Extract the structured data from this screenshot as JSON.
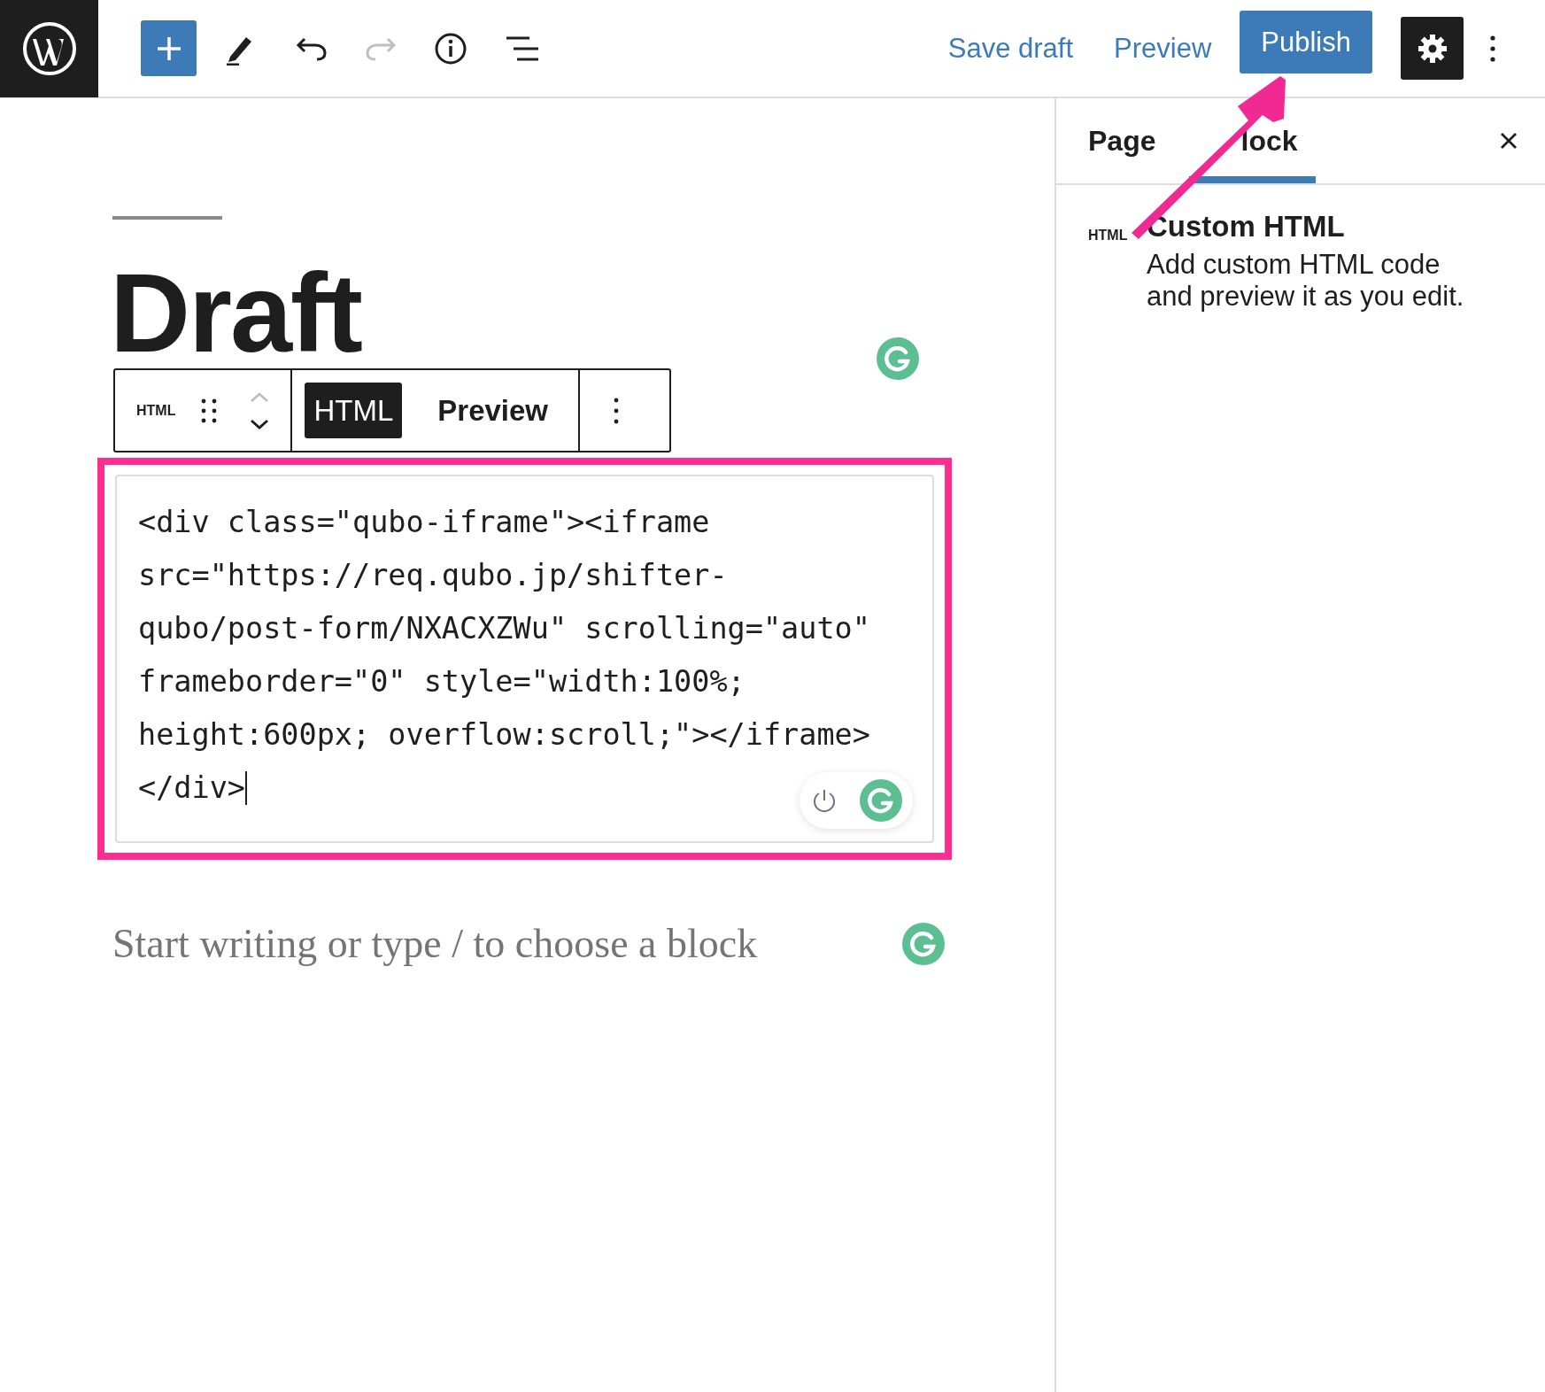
{
  "top_bar": {
    "history": [
      {
        "kind": "undo",
        "disabled": false
      },
      {
        "kind": "redo",
        "disabled": true
      }
    ],
    "save_draft": "Save draft",
    "preview": "Preview",
    "publish": "Publish",
    "settings": {
      "selected": true
    }
  },
  "editor": {
    "title": "Draft",
    "block_toolbar": {
      "block_label": "HTML",
      "modes": [
        {
          "label": "HTML",
          "selected": true
        },
        {
          "label": "Preview",
          "selected": false
        }
      ]
    },
    "code_lines": [
      "<div class=\"qubo-iframe\"><iframe",
      "src=\"https://req.qubo.jp/shifter-",
      "qubo/post-form/NXACXZWu\" scrolling=\"auto\"",
      "frameborder=\"0\" style=\"width:100%;",
      "height:600px; overflow:scroll;\"></iframe>",
      "</div>"
    ],
    "placeholder": "Start writing or type / to choose a block"
  },
  "sidebar": {
    "tabs": [
      {
        "label": "Page",
        "selected": false
      },
      {
        "label": "lock",
        "selected": true
      }
    ],
    "block_card": {
      "icon_label": "HTML",
      "title": "Custom HTML",
      "description_lines": [
        "Add custom HTML code",
        "and preview it as you edit."
      ]
    }
  }
}
